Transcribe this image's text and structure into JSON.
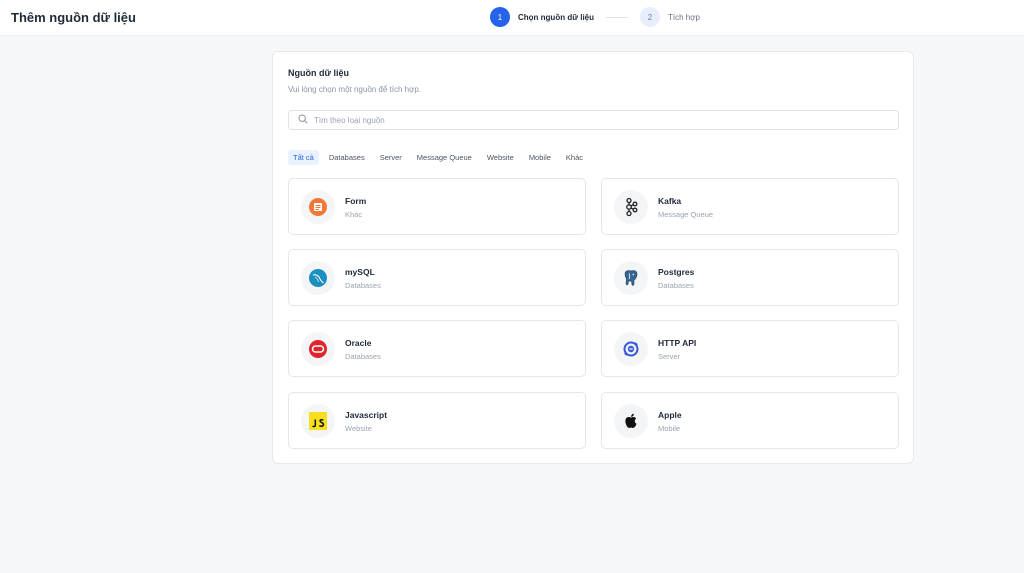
{
  "header": {
    "title": "Thêm nguồn dữ liệu"
  },
  "steps": [
    {
      "number": "1",
      "label": "Chọn nguồn dữ liệu"
    },
    {
      "number": "2",
      "label": "Tích hợp"
    }
  ],
  "panel": {
    "title": "Nguồn dữ liệu",
    "subtitle": "Vui lòng chọn một nguồn để tích hợp.",
    "search_placeholder": "Tìm theo loại nguồn"
  },
  "filters": [
    "Tất cả",
    "Databases",
    "Server",
    "Message Queue",
    "Website",
    "Mobile",
    "Khác"
  ],
  "sources": [
    {
      "name": "Form",
      "category": "Khác",
      "icon": "form-icon"
    },
    {
      "name": "Kafka",
      "category": "Message Queue",
      "icon": "kafka-icon"
    },
    {
      "name": "mySQL",
      "category": "Databases",
      "icon": "mysql-icon"
    },
    {
      "name": "Postgres",
      "category": "Databases",
      "icon": "postgres-icon"
    },
    {
      "name": "Oracle",
      "category": "Databases",
      "icon": "oracle-icon"
    },
    {
      "name": "HTTP API",
      "category": "Server",
      "icon": "http-api-icon"
    },
    {
      "name": "Javascript",
      "category": "Website",
      "icon": "javascript-icon"
    },
    {
      "name": "Apple",
      "category": "Mobile",
      "icon": "apple-icon"
    }
  ],
  "colors": {
    "accent": "#2563eb",
    "form": "#f0793a",
    "mysql": "#1d8fbf",
    "oracle": "#e0242b",
    "http_api": "#3a57d8",
    "javascript": "#f7df1e"
  }
}
